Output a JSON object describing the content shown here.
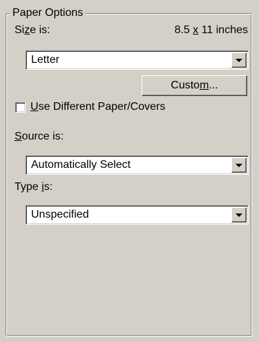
{
  "group": {
    "title": "Paper Options"
  },
  "size": {
    "label_pre": "Si",
    "label_key": "z",
    "label_post": "e is:",
    "dims_pre": "8.5 ",
    "dims_x": "x",
    "dims_post": " 11 inches",
    "selected": "Letter"
  },
  "custom_button": {
    "pre": "Custo",
    "key": "m",
    "post": "..."
  },
  "different_paper": {
    "key": "U",
    "rest": "se Different Paper/Covers",
    "checked": false
  },
  "source": {
    "key": "S",
    "rest": "ource is:",
    "selected": "Automatically Select"
  },
  "type": {
    "pre": "Type ",
    "key": "i",
    "post": "s:",
    "selected": "Unspecified"
  },
  "colors": {
    "face": "#d4d0c8",
    "field": "#ffffff",
    "shadow": "#808080",
    "highlight": "#ffffff"
  },
  "icons": {
    "dropdown": "chevron-down-icon"
  }
}
